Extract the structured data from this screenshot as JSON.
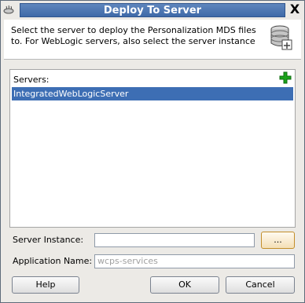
{
  "dialog": {
    "title": "Deploy To Server",
    "close_label": "X",
    "description": "Select the server to deploy the Personalization MDS files to. For WebLogic servers, also select the server instance"
  },
  "servers": {
    "label": "Servers:",
    "items": [
      "IntegratedWebLogicServer"
    ],
    "selected_index": 0
  },
  "server_instance": {
    "label": "Server Instance:",
    "value": "",
    "browse_label": "..."
  },
  "application_name": {
    "label": "Application Name:",
    "value": "wcps-services"
  },
  "buttons": {
    "help": "Help",
    "ok": "OK",
    "cancel": "Cancel"
  },
  "colors": {
    "accent": "#3d6eb4",
    "add_icon": "#1aa31a"
  },
  "icons": [
    "coffee-cup-icon",
    "close-icon",
    "database-icon",
    "add-icon"
  ]
}
